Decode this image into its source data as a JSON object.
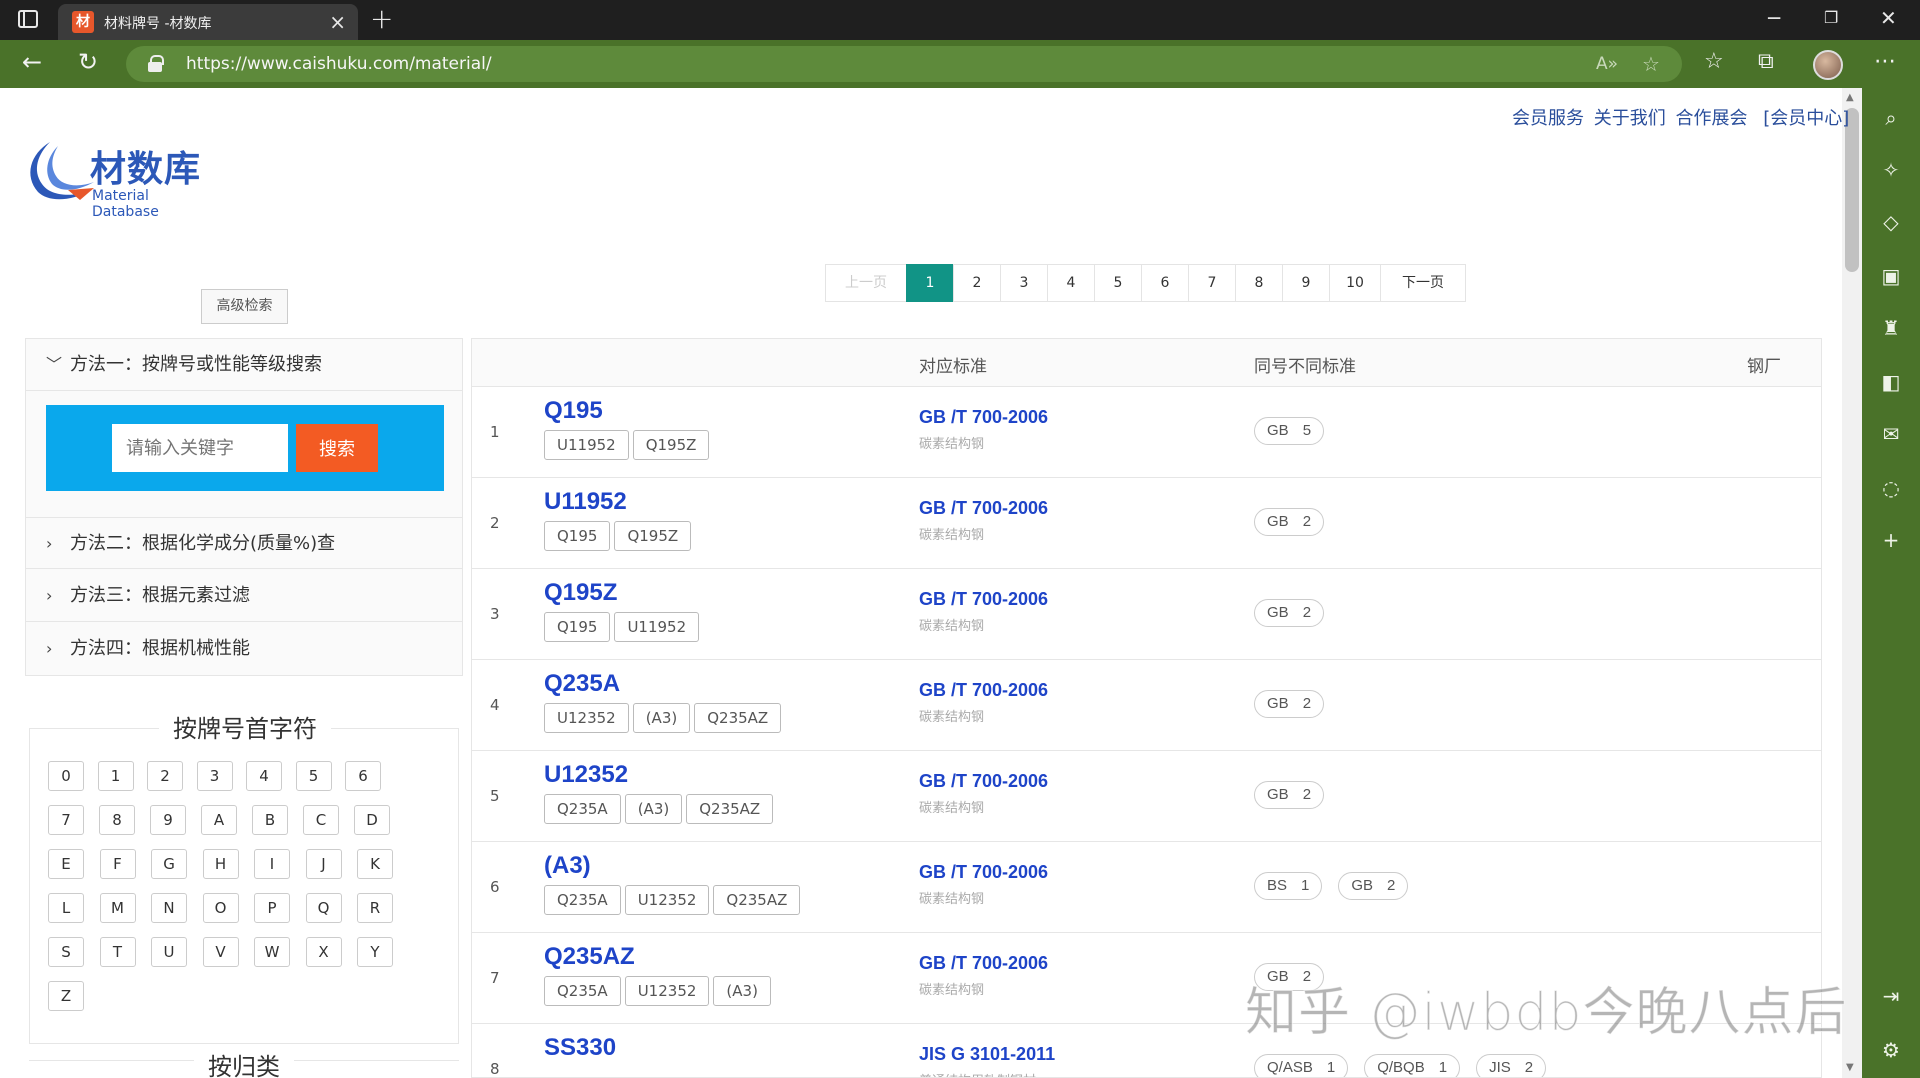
{
  "browser": {
    "tab_title": "材料牌号 -材数库",
    "favicon_text": "材",
    "url": "https://www.caishuku.com/material/"
  },
  "top_links": [
    "会员服务",
    "关于我们",
    "合作展会",
    "[会员中心]"
  ],
  "logo": {
    "cn": "材数库",
    "en": "Material Database"
  },
  "advanced_search_label": "高级检索",
  "pagination": {
    "prev": "上一页",
    "pages": [
      "1",
      "2",
      "3",
      "4",
      "5",
      "6",
      "7",
      "8",
      "9",
      "10"
    ],
    "active": "1",
    "next": "下一页"
  },
  "methods": {
    "method1": "方法一：按牌号或性能等级搜索",
    "search_placeholder": "请输入关键字",
    "search_button": "搜索",
    "method2": "方法二：根据化学成分(质量%)查",
    "method3": "方法三：根据元素过滤",
    "method4": "方法四：根据机械性能"
  },
  "letters_title": "按牌号首字符",
  "letters": [
    "0",
    "1",
    "2",
    "3",
    "4",
    "5",
    "6",
    "7",
    "8",
    "9",
    "A",
    "B",
    "C",
    "D",
    "E",
    "F",
    "G",
    "H",
    "I",
    "J",
    "K",
    "L",
    "M",
    "N",
    "O",
    "P",
    "Q",
    "R",
    "S",
    "T",
    "U",
    "V",
    "W",
    "X",
    "Y",
    "Z"
  ],
  "category_title": "按归类",
  "table_headers": {
    "standard": "对应标准",
    "same_grade": "同号不同标准",
    "mill": "钢厂"
  },
  "rows": [
    {
      "n": "1",
      "grade": "Q195",
      "aliases": [
        "U11952",
        "Q195Z"
      ],
      "std": "GB /T 700-2006",
      "std_sub": "碳素结构钢",
      "others": [
        {
          "s": "GB",
          "c": "5"
        }
      ]
    },
    {
      "n": "2",
      "grade": "U11952",
      "aliases": [
        "Q195",
        "Q195Z"
      ],
      "std": "GB /T 700-2006",
      "std_sub": "碳素结构钢",
      "others": [
        {
          "s": "GB",
          "c": "2"
        }
      ]
    },
    {
      "n": "3",
      "grade": "Q195Z",
      "aliases": [
        "Q195",
        "U11952"
      ],
      "std": "GB /T 700-2006",
      "std_sub": "碳素结构钢",
      "others": [
        {
          "s": "GB",
          "c": "2"
        }
      ]
    },
    {
      "n": "4",
      "grade": "Q235A",
      "aliases": [
        "U12352",
        "(A3)",
        "Q235AZ"
      ],
      "std": "GB /T 700-2006",
      "std_sub": "碳素结构钢",
      "others": [
        {
          "s": "GB",
          "c": "2"
        }
      ]
    },
    {
      "n": "5",
      "grade": "U12352",
      "aliases": [
        "Q235A",
        "(A3)",
        "Q235AZ"
      ],
      "std": "GB /T 700-2006",
      "std_sub": "碳素结构钢",
      "others": [
        {
          "s": "GB",
          "c": "2"
        }
      ]
    },
    {
      "n": "6",
      "grade": "(A3)",
      "aliases": [
        "Q235A",
        "U12352",
        "Q235AZ"
      ],
      "std": "GB /T 700-2006",
      "std_sub": "碳素结构钢",
      "others": [
        {
          "s": "BS",
          "c": "1"
        },
        {
          "s": "GB",
          "c": "2"
        }
      ]
    },
    {
      "n": "7",
      "grade": "Q235AZ",
      "aliases": [
        "Q235A",
        "U12352",
        "(A3)"
      ],
      "std": "GB /T 700-2006",
      "std_sub": "碳素结构钢",
      "others": [
        {
          "s": "GB",
          "c": "2"
        }
      ]
    },
    {
      "n": "8",
      "grade": "SS330",
      "aliases": [],
      "std": "JIS G 3101-2011",
      "std_sub": "普通结构用轧制钢材",
      "others": [
        {
          "s": "Q/ASB",
          "c": "1"
        },
        {
          "s": "Q/BQB",
          "c": "1"
        },
        {
          "s": "JIS",
          "c": "2"
        }
      ]
    }
  ],
  "watermark": "知乎 @iwbdb今晚八点后"
}
